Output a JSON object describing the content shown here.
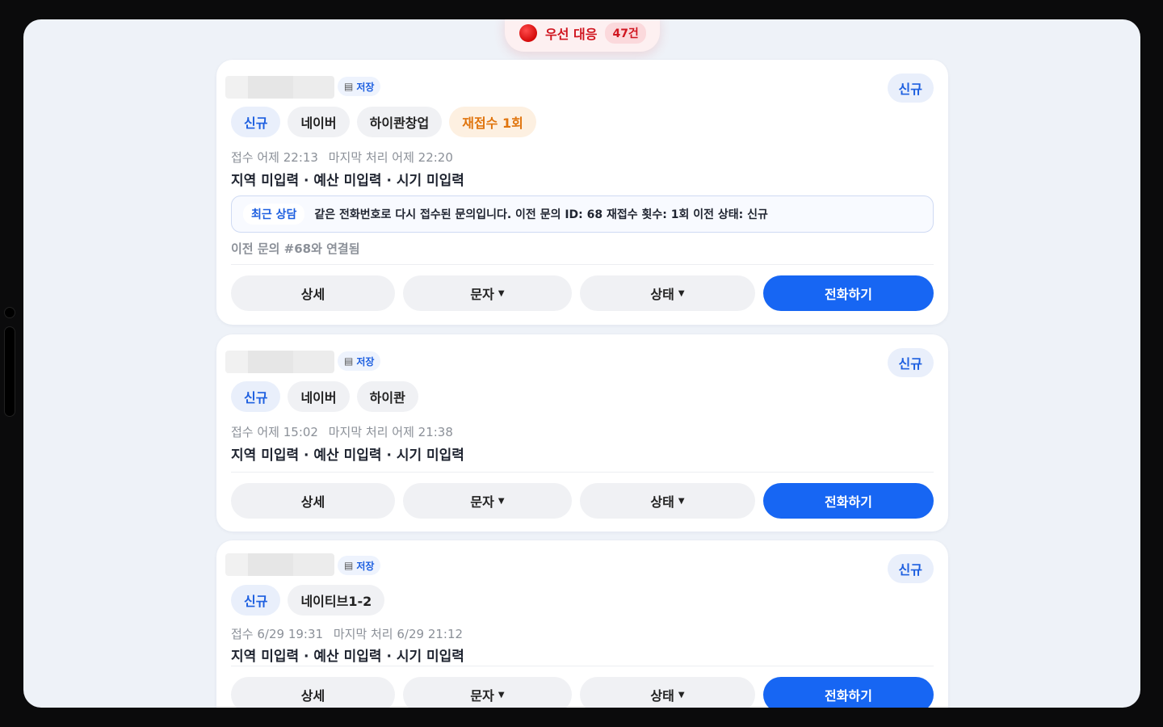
{
  "priority": {
    "label": "우선 대응",
    "count": "47건"
  },
  "cards": [
    {
      "store_label": "저장",
      "status": "신규",
      "tags": [
        "신규",
        "네이버",
        "하이콴창업",
        "재접수 1회"
      ],
      "meta_received": "접수 어제 22:13",
      "meta_last": "마지막 처리 어제 22:20",
      "summary": "지역 미입력 · 예산 미입력 · 시기 미입력",
      "consult_tag": "최근 상담",
      "consult_text": "같은 전화번호로 다시 접수된 문의입니다. 이전 문의 ID: 68 재접수 횟수: 1회 이전 상태: 신규",
      "linked": "이전 문의 #68와 연결됨",
      "buttons": {
        "detail": "상세",
        "sms": "문자",
        "state": "상태",
        "call": "전화하기"
      }
    },
    {
      "store_label": "저장",
      "status": "신규",
      "tags": [
        "신규",
        "네이버",
        "하이콴"
      ],
      "meta_received": "접수 어제 15:02",
      "meta_last": "마지막 처리 어제 21:38",
      "summary": "지역 미입력 · 예산 미입력 · 시기 미입력",
      "buttons": {
        "detail": "상세",
        "sms": "문자",
        "state": "상태",
        "call": "전화하기"
      }
    },
    {
      "store_label": "저장",
      "status": "신규",
      "tags": [
        "신규",
        "네이티브1-2"
      ],
      "meta_received": "접수 6/29 19:31",
      "meta_last": "마지막 처리 6/29 21:12",
      "summary": "지역 미입력 · 예산 미입력 · 시기 미입력",
      "buttons": {
        "detail": "상세",
        "sms": "문자",
        "state": "상태",
        "call": "전화하기"
      }
    }
  ]
}
